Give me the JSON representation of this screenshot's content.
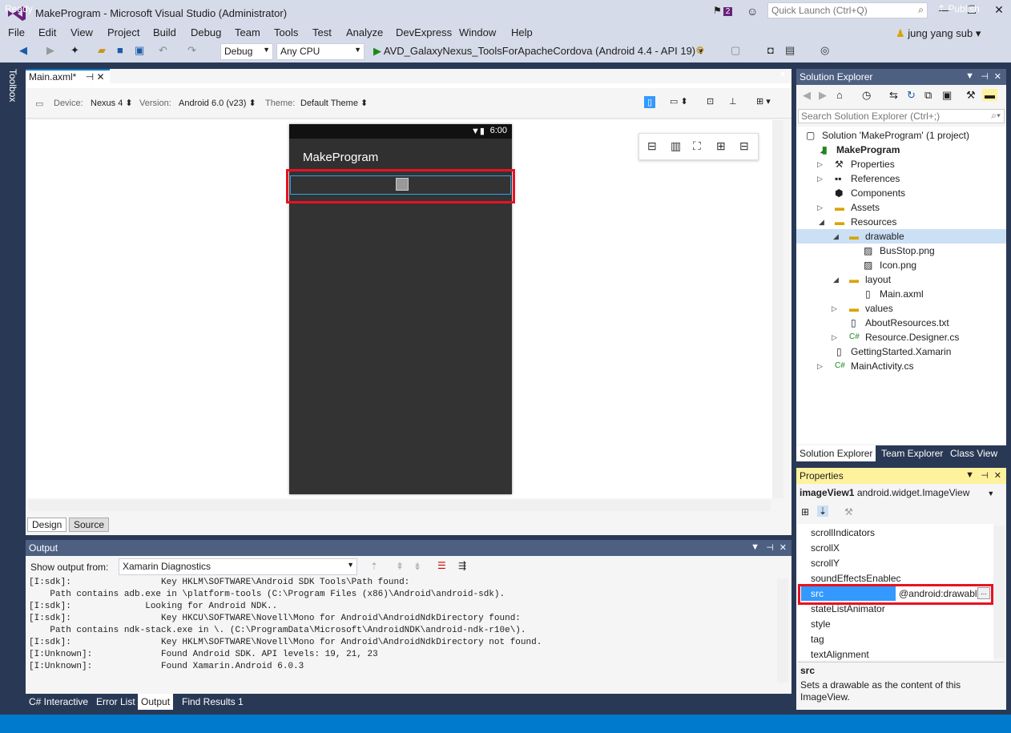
{
  "window": {
    "title": "MakeProgram - Microsoft Visual Studio (Administrator)",
    "notification_count": "2",
    "quick_launch_placeholder": "Quick Launch (Ctrl+Q)",
    "user": "jung yang sub"
  },
  "menu": [
    "File",
    "Edit",
    "View",
    "Project",
    "Build",
    "Debug",
    "Team",
    "Tools",
    "Test",
    "Analyze",
    "DevExpress",
    "Window",
    "Help"
  ],
  "toolbar": {
    "configuration": "Debug",
    "platform": "Any CPU",
    "run_target": "AVD_GalaxyNexus_ToolsForApacheCordova (Android 4.4 - API 19)"
  },
  "toolbox_label": "Toolbox",
  "document": {
    "tab": "Main.axml*",
    "device_label": "Device:",
    "device": "Nexus 4",
    "version_label": "Version:",
    "version": "Android 6.0 (v23)",
    "theme_label": "Theme:",
    "theme": "Default Theme",
    "phone_time": "6:00",
    "app_title": "MakeProgram",
    "design_tab": "Design",
    "source_tab": "Source"
  },
  "output": {
    "title": "Output",
    "show_from_label": "Show output from:",
    "source": "Xamarin Diagnostics",
    "lines": [
      "[I:sdk]:                 Key HKLM\\SOFTWARE\\Android SDK Tools\\Path found:",
      "    Path contains adb.exe in \\platform-tools (C:\\Program Files (x86)\\Android\\android-sdk).",
      "[I:sdk]:              Looking for Android NDK..",
      "[I:sdk]:                 Key HKCU\\SOFTWARE\\Novell\\Mono for Android\\AndroidNdkDirectory found:",
      "    Path contains ndk-stack.exe in \\. (C:\\ProgramData\\Microsoft\\AndroidNDK\\android-ndk-r10e\\).",
      "[I:sdk]:                 Key HKLM\\SOFTWARE\\Novell\\Mono for Android\\AndroidNdkDirectory not found.",
      "[I:Unknown]:             Found Android SDK. API levels: 19, 21, 23",
      "[I:Unknown]:             Found Xamarin.Android 6.0.3"
    ]
  },
  "bottom_tabs": [
    "C# Interactive",
    "Error List",
    "Output",
    "Find Results 1"
  ],
  "status": {
    "text": "Ready",
    "publish": "Publish"
  },
  "solution_explorer": {
    "title": "Solution Explorer",
    "search_placeholder": "Search Solution Explorer (Ctrl+;)",
    "items": [
      {
        "label": "Solution 'MakeProgram' (1 project)",
        "level": 0,
        "icon": "solution-icon",
        "expander": ""
      },
      {
        "label": "MakeProgram",
        "level": 1,
        "icon": "project-icon",
        "expander": "◢"
      },
      {
        "label": "Properties",
        "level": 2,
        "icon": "wrench-icon",
        "expander": "▷"
      },
      {
        "label": "References",
        "level": 2,
        "icon": "references-icon",
        "expander": "▷"
      },
      {
        "label": "Components",
        "level": 2,
        "icon": "component-icon",
        "expander": ""
      },
      {
        "label": "Assets",
        "level": 2,
        "icon": "folder-icon",
        "expander": "▷"
      },
      {
        "label": "Resources",
        "level": 2,
        "icon": "folder-open-icon",
        "expander": "◢"
      },
      {
        "label": "drawable",
        "level": 3,
        "icon": "folder-open-icon",
        "expander": "◢"
      },
      {
        "label": "BusStop.png",
        "level": 4,
        "icon": "image-file-icon",
        "expander": ""
      },
      {
        "label": "Icon.png",
        "level": 4,
        "icon": "image-file-icon",
        "expander": ""
      },
      {
        "label": "layout",
        "level": 3,
        "icon": "folder-open-icon",
        "expander": "◢"
      },
      {
        "label": "Main.axml",
        "level": 4,
        "icon": "file-icon",
        "expander": ""
      },
      {
        "label": "values",
        "level": 3,
        "icon": "folder-icon",
        "expander": "▷"
      },
      {
        "label": "AboutResources.txt",
        "level": 3,
        "icon": "file-icon",
        "expander": ""
      },
      {
        "label": "Resource.Designer.cs",
        "level": 3,
        "icon": "csharp-icon",
        "expander": "▷"
      },
      {
        "label": "GettingStarted.Xamarin",
        "level": 2,
        "icon": "file-icon",
        "expander": ""
      },
      {
        "label": "MainActivity.cs",
        "level": 2,
        "icon": "csharp-icon",
        "expander": "▷"
      }
    ],
    "selected_item": "drawable",
    "tabs": [
      "Solution Explorer",
      "Team Explorer",
      "Class View"
    ]
  },
  "properties": {
    "title": "Properties",
    "object_name": "imageView1",
    "object_type": "android.widget.ImageView",
    "rows": [
      "scrollIndicators",
      "scrollX",
      "scrollY",
      "soundEffectsEnablec"
    ],
    "rows_after": [
      "stateListAnimator",
      "style",
      "tag",
      "textAlignment"
    ],
    "src_name": "src",
    "src_value": "@android:drawabl",
    "src_button": "...",
    "desc_title": "src",
    "desc_text": "Sets a drawable as the content of this ImageView."
  },
  "colors": {
    "accent": "#007acc",
    "highlight_red": "#e81123",
    "panel_header": "#4d6082",
    "properties_header": "#fff29d",
    "frame": "#293955"
  }
}
